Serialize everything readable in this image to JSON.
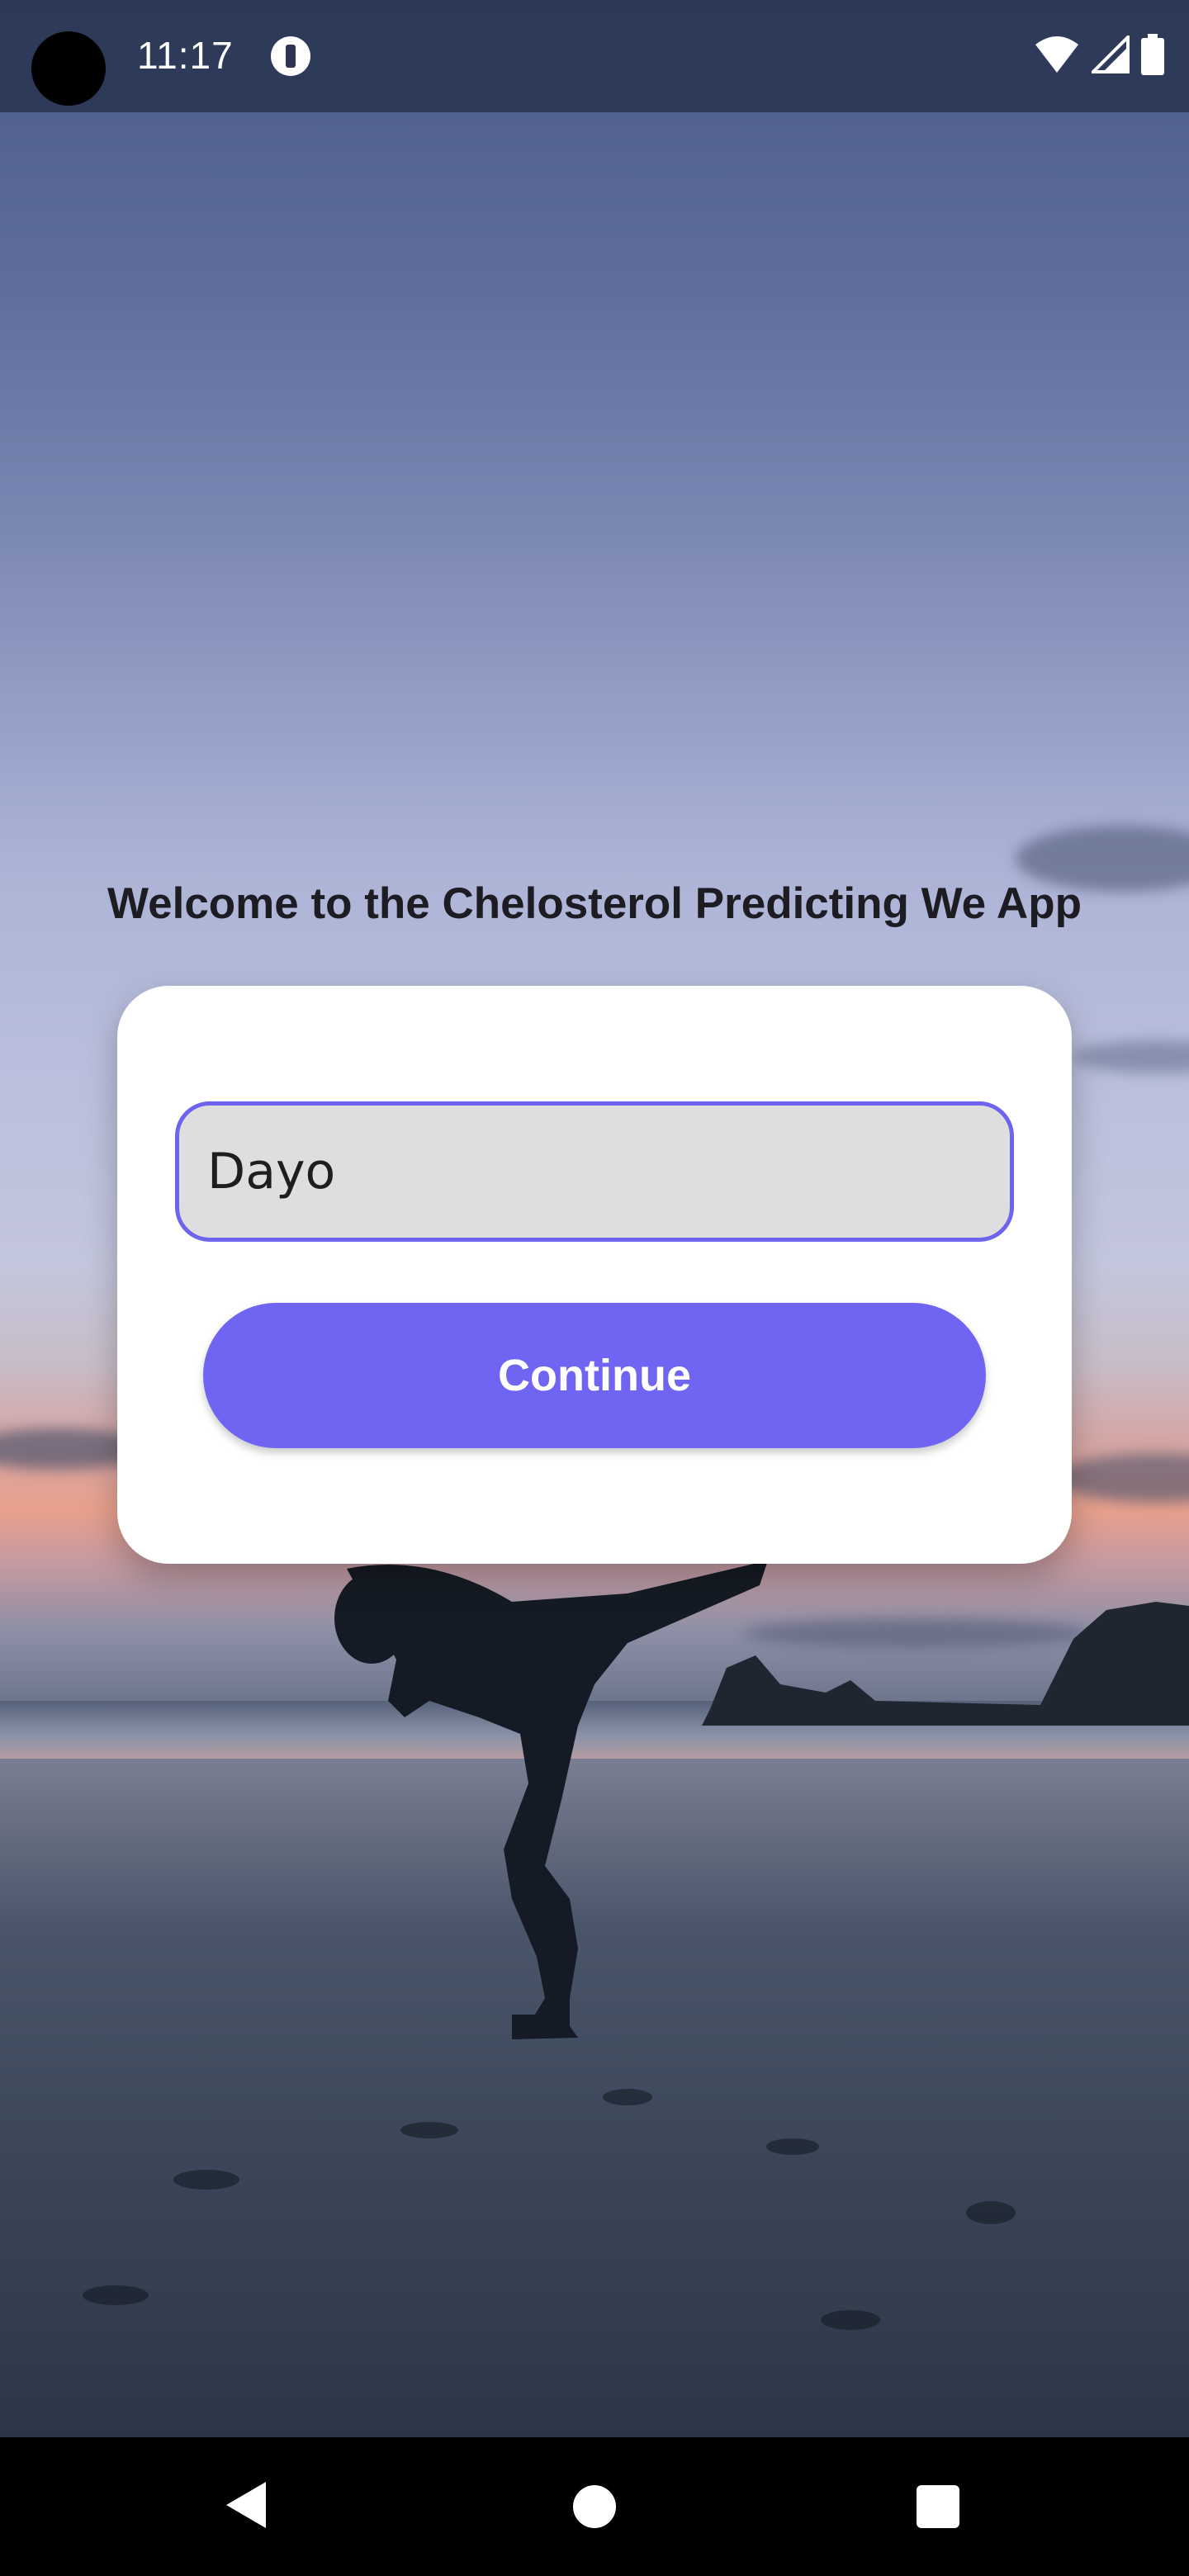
{
  "status_bar": {
    "time": "11:17",
    "icons": [
      "camera-cutout",
      "app-notification-icon",
      "wifi-icon",
      "cell-signal-icon",
      "battery-icon"
    ]
  },
  "welcome": {
    "text": "Welcome to the Chelosterol Predicting We App"
  },
  "form": {
    "name_value": "Dayo",
    "continue_label": "Continue",
    "accent_color": "#7065f2",
    "input_border_color": "#6d63ee"
  },
  "nav_bar": {
    "icons": [
      "back-icon",
      "home-icon",
      "recents-icon"
    ]
  }
}
